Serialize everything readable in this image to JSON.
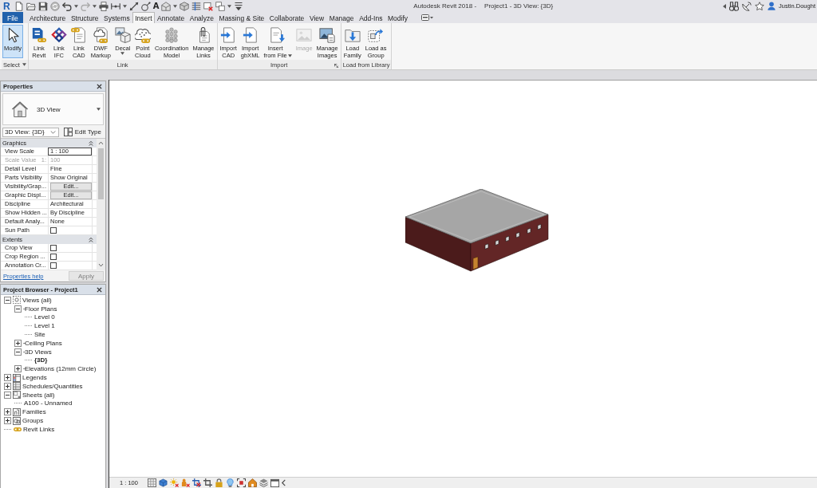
{
  "title_bar": {
    "logo": "R",
    "text_tool": "A",
    "app_title": "Autodesk Revit 2018 -",
    "document_title": "Project1 - 3D View: {3D}",
    "user": "Justin.Dought"
  },
  "ribbon_tabs": [
    {
      "label": "File",
      "kind": "file",
      "selected": false
    },
    {
      "label": "Architecture",
      "kind": "tab",
      "selected": false
    },
    {
      "label": "Structure",
      "kind": "tab",
      "selected": false
    },
    {
      "label": "Systems",
      "kind": "tab",
      "selected": false
    },
    {
      "label": "Insert",
      "kind": "tab",
      "selected": true
    },
    {
      "label": "Annotate",
      "kind": "tab",
      "selected": false
    },
    {
      "label": "Analyze",
      "kind": "tab",
      "selected": false
    },
    {
      "label": "Massing & Site",
      "kind": "tab",
      "selected": false
    },
    {
      "label": "Collaborate",
      "kind": "tab",
      "selected": false
    },
    {
      "label": "View",
      "kind": "tab",
      "selected": false
    },
    {
      "label": "Manage",
      "kind": "tab",
      "selected": false
    },
    {
      "label": "Add-Ins",
      "kind": "tab",
      "selected": false
    },
    {
      "label": "Modify",
      "kind": "tab",
      "selected": false
    }
  ],
  "ribbon_panels": [
    {
      "label": "Select",
      "dropdown": true,
      "launcher": false,
      "tools": [
        {
          "label": "Modify",
          "kind": "modify",
          "selected": true,
          "disabled": false,
          "dropdown": false
        }
      ]
    },
    {
      "label": "Link",
      "dropdown": false,
      "launcher": false,
      "tools": [
        {
          "label": "Link\nRevit",
          "kind": "link-revit",
          "selected": false,
          "disabled": false,
          "dropdown": false
        },
        {
          "label": "Link\nIFC",
          "kind": "link-ifc",
          "selected": false,
          "disabled": false,
          "dropdown": false
        },
        {
          "label": "Link\nCAD",
          "kind": "link-cad",
          "selected": false,
          "disabled": false,
          "dropdown": false
        },
        {
          "label": "DWF\nMarkup",
          "kind": "dwf-markup",
          "selected": false,
          "disabled": false,
          "dropdown": false
        },
        {
          "label": "Decal",
          "kind": "decal",
          "selected": false,
          "disabled": false,
          "dropdown": true
        },
        {
          "label": "Point\nCloud",
          "kind": "point-cloud",
          "selected": false,
          "disabled": false,
          "dropdown": false
        },
        {
          "label": "Coordination\nModel",
          "kind": "coordination-model",
          "selected": false,
          "disabled": false,
          "dropdown": false
        },
        {
          "label": "Manage\nLinks",
          "kind": "manage-links",
          "selected": false,
          "disabled": false,
          "dropdown": false
        }
      ]
    },
    {
      "label": "Import",
      "dropdown": false,
      "launcher": true,
      "tools": [
        {
          "label": "Import\nCAD",
          "kind": "import-cad",
          "selected": false,
          "disabled": false,
          "dropdown": false
        },
        {
          "label": "Import\ngbXML",
          "kind": "import-gbxml",
          "selected": false,
          "disabled": false,
          "dropdown": false
        },
        {
          "label": "Insert\nfrom File",
          "kind": "insert-from-file",
          "selected": false,
          "disabled": false,
          "dropdown": true
        },
        {
          "label": "Image",
          "kind": "image",
          "selected": false,
          "disabled": true,
          "dropdown": false
        },
        {
          "label": "Manage\nImages",
          "kind": "manage-images",
          "selected": false,
          "disabled": false,
          "dropdown": false
        }
      ]
    },
    {
      "label": "Load from Library",
      "dropdown": false,
      "launcher": false,
      "tools": [
        {
          "label": "Load\nFamily",
          "kind": "load-family",
          "selected": false,
          "disabled": false,
          "dropdown": false
        },
        {
          "label": "Load as\nGroup",
          "kind": "load-as-group",
          "selected": false,
          "disabled": false,
          "dropdown": false
        }
      ]
    }
  ],
  "properties": {
    "title": "Properties",
    "type_name": "3D View",
    "instance": "3D View: {3D}",
    "edit_type": "Edit Type",
    "groups": [
      {
        "label": "Graphics",
        "expanded": true,
        "rows": [
          {
            "name": "View Scale",
            "kind": "field",
            "value": "1 : 100",
            "disabled": false
          },
          {
            "name": "Scale Value   1:",
            "kind": "text",
            "value": "100",
            "disabled": true
          },
          {
            "name": "Detail Level",
            "kind": "text",
            "value": "Fine",
            "disabled": false
          },
          {
            "name": "Parts Visibility",
            "kind": "text",
            "value": "Show Original",
            "disabled": false
          },
          {
            "name": "Visibility/Grap...",
            "kind": "button",
            "value": "Edit...",
            "disabled": false
          },
          {
            "name": "Graphic Displ...",
            "kind": "button",
            "value": "Edit...",
            "disabled": false
          },
          {
            "name": "Discipline",
            "kind": "text",
            "value": "Architectural",
            "disabled": false
          },
          {
            "name": "Show Hidden ...",
            "kind": "text",
            "value": "By Discipline",
            "disabled": false
          },
          {
            "name": "Default Analy...",
            "kind": "text",
            "value": "None",
            "disabled": false
          },
          {
            "name": "Sun Path",
            "kind": "checkbox",
            "checked": false,
            "disabled": false
          }
        ]
      },
      {
        "label": "Extents",
        "expanded": true,
        "rows": [
          {
            "name": "Crop View",
            "kind": "checkbox",
            "checked": false,
            "disabled": false
          },
          {
            "name": "Crop Region ...",
            "kind": "checkbox",
            "checked": false,
            "disabled": false
          },
          {
            "name": "Annotation Cr...",
            "kind": "checkbox",
            "checked": false,
            "disabled": false
          }
        ]
      }
    ],
    "help_link": "Properties help",
    "apply": {
      "label": "Apply",
      "disabled": true
    }
  },
  "project_browser": {
    "title": "Project Browser - Project1",
    "tree": [
      {
        "label": "Views (all)",
        "kind": "views",
        "expanded": true,
        "selected": false,
        "children": [
          {
            "label": "Floor Plans",
            "expanded": true,
            "selected": false,
            "children": [
              {
                "label": "Level 0",
                "selected": false
              },
              {
                "label": "Level 1",
                "selected": false
              },
              {
                "label": "Site",
                "selected": false
              }
            ]
          },
          {
            "label": "Ceiling Plans",
            "expanded": false,
            "selected": false
          },
          {
            "label": "3D Views",
            "expanded": true,
            "selected": false,
            "children": [
              {
                "label": "{3D}",
                "selected": true
              }
            ]
          },
          {
            "label": "Elevations (12mm Circle)",
            "expanded": false,
            "selected": false
          }
        ]
      },
      {
        "label": "Legends",
        "kind": "legends",
        "expanded": false,
        "selected": false
      },
      {
        "label": "Schedules/Quantities",
        "kind": "schedules",
        "expanded": false,
        "selected": false
      },
      {
        "label": "Sheets (all)",
        "kind": "sheets",
        "expanded": true,
        "selected": false,
        "children": [
          {
            "label": "A100 - Unnamed",
            "selected": false
          }
        ]
      },
      {
        "label": "Families",
        "kind": "families",
        "expanded": false,
        "selected": false
      },
      {
        "label": "Groups",
        "kind": "groups",
        "expanded": false,
        "selected": false
      },
      {
        "label": "Revit Links",
        "kind": "links",
        "selected": false
      }
    ]
  },
  "view_control_bar": {
    "scale": "1 : 100"
  }
}
